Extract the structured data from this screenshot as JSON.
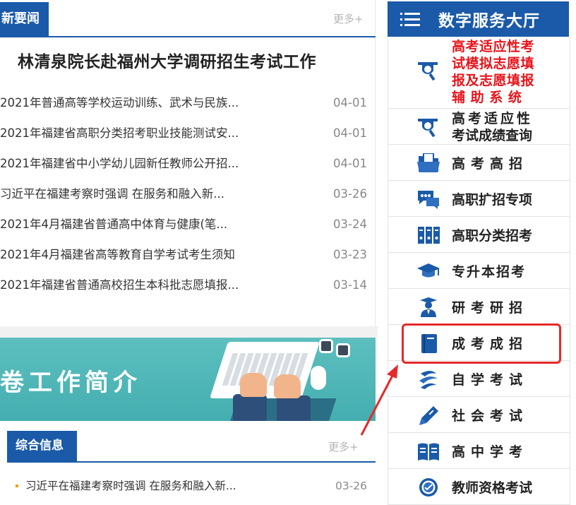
{
  "news": {
    "tab_label": "新要闻",
    "more_label": "更多+",
    "headline": "林清泉院长赴福州大学调研招生考试工作",
    "items": [
      {
        "title": "2021年普通高等学校运动训练、武术与民族...",
        "date": "04-01"
      },
      {
        "title": "2021年福建省高职分类招考职业技能测试安...",
        "date": "04-01"
      },
      {
        "title": "2021年福建省中小学幼儿园新任教师公开招...",
        "date": "04-01"
      },
      {
        "title": "习近平在福建考察时强调 在服务和融入新...",
        "date": "03-26"
      },
      {
        "title": "2021年4月福建省普通高中体育与健康(笔...",
        "date": "03-24"
      },
      {
        "title": "2021年4月福建省高等教育自学考试考生须知",
        "date": "03-23"
      },
      {
        "title": "2021年福建省普通高校招生本科批志愿填报...",
        "date": "03-14"
      }
    ]
  },
  "banner": {
    "text": "卷工作简介"
  },
  "info": {
    "tab_label": "综合信息",
    "more_label": "更多+",
    "items": [
      {
        "title": "习近平在福建考察时强调 在服务和融入新...",
        "date": "03-26"
      }
    ]
  },
  "hall": {
    "title": "数字服务大厅",
    "accent_color": "#1a5aa8",
    "highlight_color": "#e42a2a",
    "items": [
      {
        "lines": [
          "高考适应性考",
          "试模拟志愿填",
          "报及志愿填报",
          "辅 助 系 统"
        ],
        "icon": "magnifier-icon",
        "color": "#e8141b"
      },
      {
        "lines": [
          "高考适应性",
          "考试成绩查询"
        ],
        "icon": "magnifier-icon"
      },
      {
        "label": "高考高招",
        "icon": "folder-icon"
      },
      {
        "label": "高职扩招专项",
        "icon": "chat-icon"
      },
      {
        "label": "高职分类招考",
        "icon": "binders-icon"
      },
      {
        "label": "专升本招考",
        "icon": "graduation-cap-icon"
      },
      {
        "label": "研考研招",
        "icon": "graduate-icon"
      },
      {
        "label": "成考成招",
        "icon": "book-icon"
      },
      {
        "label": "自学考试",
        "icon": "swirl-icon"
      },
      {
        "label": "社会考试",
        "icon": "pen-icon"
      },
      {
        "label": "高中学考",
        "icon": "open-book-icon"
      },
      {
        "label": "教师资格考试",
        "icon": "seal-icon"
      }
    ]
  }
}
